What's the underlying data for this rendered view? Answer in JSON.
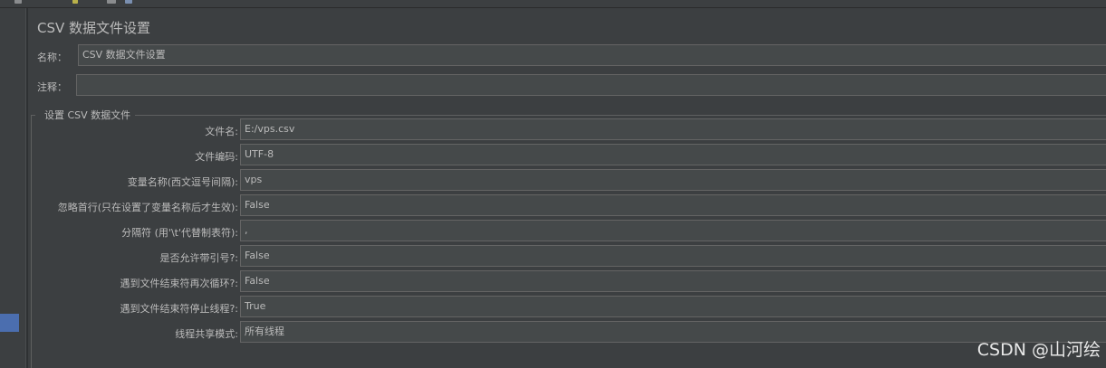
{
  "panel": {
    "title": "CSV 数据文件设置",
    "name_label": "名称：",
    "name_value": "CSV 数据文件设置",
    "comment_label": "注释：",
    "comment_value": ""
  },
  "group": {
    "title": "设置 CSV 数据文件"
  },
  "form": {
    "rows": [
      {
        "label": "文件名:",
        "value": "E:/vps.csv"
      },
      {
        "label": "文件编码:",
        "value": "UTF-8"
      },
      {
        "label": "变量名称(西文逗号间隔):",
        "value": "vps"
      },
      {
        "label": "忽略首行(只在设置了变量名称后才生效):",
        "value": "False"
      },
      {
        "label": "分隔符 (用'\\t'代替制表符):",
        "value": ","
      },
      {
        "label": "是否允许带引号?:",
        "value": "False"
      },
      {
        "label": "遇到文件结束符再次循环?:",
        "value": "False"
      },
      {
        "label": "遇到文件结束符停止线程?:",
        "value": "True"
      },
      {
        "label": "线程共享模式:",
        "value": "所有线程"
      }
    ]
  },
  "watermark": "CSDN @山河绘",
  "colors": {
    "background": "#3c3f41",
    "field_background": "#45494a",
    "field_border": "#646464",
    "text": "#bbbbbb",
    "selection": "#4b6eaf"
  }
}
